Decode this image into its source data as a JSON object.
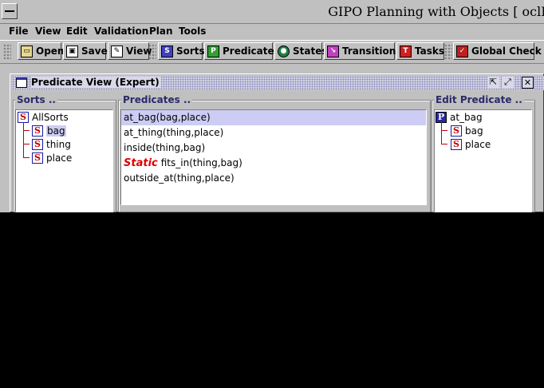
{
  "app": {
    "title": "GIPO Planning with Objects [ oclB"
  },
  "menu": [
    "File",
    "View",
    "Edit",
    "Validation",
    "Plan",
    "Tools"
  ],
  "toolbar": [
    {
      "label": "Open",
      "icon": "folder-open-icon"
    },
    {
      "label": "Save",
      "icon": "floppy-disk-icon"
    },
    {
      "label": "View",
      "icon": "notepad-pencil-icon"
    },
    {
      "label": "Sorts",
      "icon": "sorts-cube-icon"
    },
    {
      "label": "Predicates",
      "icon": "predicates-cube-icon"
    },
    {
      "label": "States",
      "icon": "states-globe-icon"
    },
    {
      "label": "Transitions",
      "icon": "transitions-icon"
    },
    {
      "label": "Tasks",
      "icon": "tasks-icon"
    },
    {
      "label": "Global Check",
      "icon": "global-check-icon"
    }
  ],
  "window": {
    "title": "Predicate View (Expert)",
    "sorts_label": "Sorts ..",
    "predicates_label": "Predicates ..",
    "edit_label": "Edit Predicate .."
  },
  "sorts_tree": {
    "root": "AllSorts",
    "children": [
      "bag",
      "thing",
      "place"
    ],
    "selected": "bag"
  },
  "predicates": [
    {
      "text": "at_bag(bag,place)",
      "selected": true,
      "static": false
    },
    {
      "text": "at_thing(thing,place)",
      "selected": false,
      "static": false
    },
    {
      "text": "inside(thing,bag)",
      "selected": false,
      "static": false
    },
    {
      "text": "fits_in(thing,bag)",
      "selected": false,
      "static": true
    },
    {
      "text": "outside_at(thing,place)",
      "selected": false,
      "static": false
    }
  ],
  "static_keyword": "Static",
  "edit_tree": {
    "root": "at_bag",
    "children": [
      "bag",
      "place"
    ]
  },
  "colors": {
    "chrome": "#c0c0c0",
    "selection": "#ccccf4",
    "static": "#e00000",
    "sort_icon": "#c00000"
  }
}
